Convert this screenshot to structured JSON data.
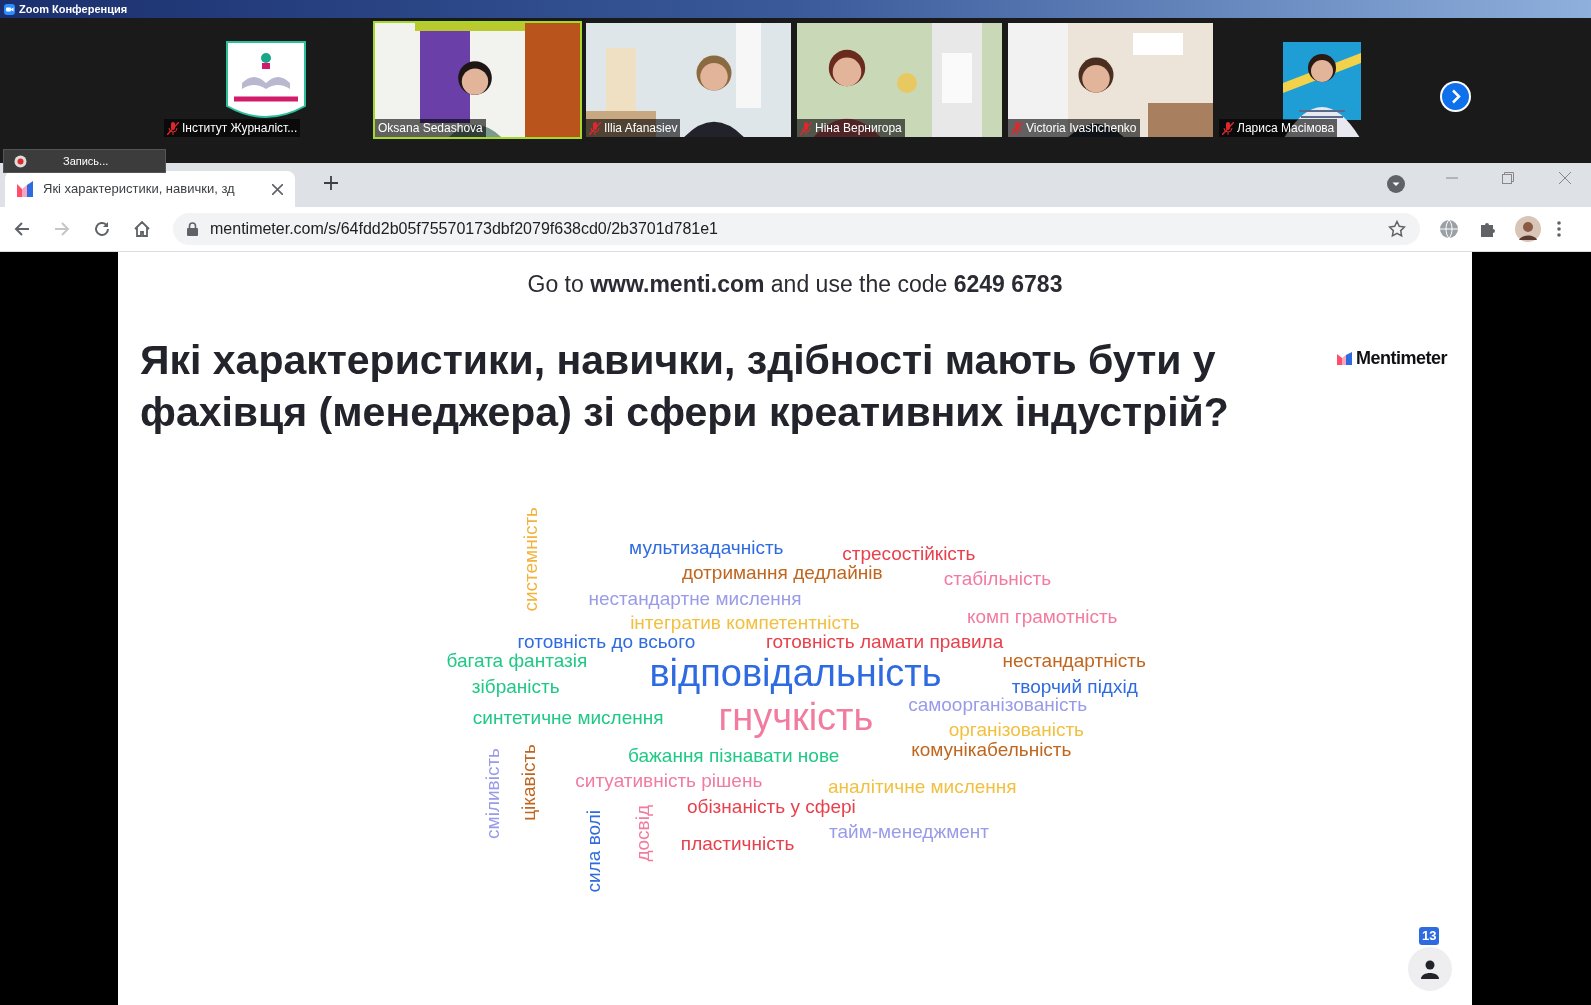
{
  "app": {
    "title": "Zoom Конференция"
  },
  "participants": [
    {
      "name": "Інститут Журналіст...",
      "muted": true,
      "speaking": false,
      "kind": "profile"
    },
    {
      "name": "Oksana Sedashova",
      "muted": false,
      "speaking": true,
      "kind": "video"
    },
    {
      "name": "Illia Afanasiev",
      "muted": true,
      "speaking": false,
      "kind": "video"
    },
    {
      "name": "Ніна Вернигора",
      "muted": true,
      "speaking": false,
      "kind": "video"
    },
    {
      "name": "Victoria Ivashchenko",
      "muted": true,
      "speaking": false,
      "kind": "video"
    },
    {
      "name": "Лариса Масімова",
      "muted": true,
      "speaking": false,
      "kind": "profile"
    }
  ],
  "recording": {
    "label": "Запись..."
  },
  "browser": {
    "tabs": [
      {
        "title": "Які характеристики, навички, зд",
        "selected": true
      }
    ],
    "address": "mentimeter.com/s/64fdd2b05f75570173dbf2079f638cd0/2b3701d781e1",
    "forward_disabled": true
  },
  "slide": {
    "instructions": "Go to **www.menti.com** and use the code **6249 6783**",
    "brand": "Mentimeter",
    "question": "Які характеристики, навички, здібності мають бути у фахівця (менеджера) зі сфери креативних індустрій?",
    "words": [
      {
        "text": "системність",
        "color": "#f2b33d",
        "kind": "vertical"
      },
      {
        "text": "мультизадачність",
        "color": "#2f6be0",
        "kind": "horizontal"
      },
      {
        "text": "стресостійкість",
        "color": "#e8404c",
        "kind": "horizontal"
      },
      {
        "text": "дотримання дедлайнів",
        "color": "#c0661e",
        "kind": "horizontal"
      },
      {
        "text": "стабільність",
        "color": "#f27ba0",
        "kind": "horizontal"
      },
      {
        "text": "нестандартне мислення",
        "color": "#9a9be8",
        "kind": "horizontal"
      },
      {
        "text": "інтегратив компетентність",
        "color": "#f2c040",
        "kind": "horizontal"
      },
      {
        "text": "комп грамотність",
        "color": "#f27ba0",
        "kind": "horizontal"
      },
      {
        "text": "готовність до всього",
        "color": "#2f6be0",
        "kind": "horizontal"
      },
      {
        "text": "готовність ламати правила",
        "color": "#e8404c",
        "kind": "horizontal"
      },
      {
        "text": "багата фантазія",
        "color": "#1fc985",
        "kind": "horizontal"
      },
      {
        "text": "відповідальність",
        "color": "#2f6be0",
        "kind": "headline"
      },
      {
        "text": "нестандартність",
        "color": "#c0661e",
        "kind": "horizontal"
      },
      {
        "text": "зібраність",
        "color": "#1fc985",
        "kind": "horizontal"
      },
      {
        "text": "творчий підхід",
        "color": "#2f6be0",
        "kind": "horizontal"
      },
      {
        "text": "самоорганізованість",
        "color": "#9a9be8",
        "kind": "horizontal"
      },
      {
        "text": "синтетичне мислення",
        "color": "#1fc985",
        "kind": "horizontal"
      },
      {
        "text": "гнучкість",
        "color": "#f27ba0",
        "kind": "headline"
      },
      {
        "text": "організованість",
        "color": "#f2c040",
        "kind": "horizontal"
      },
      {
        "text": "бажання пізнавати нове",
        "color": "#1fc985",
        "kind": "horizontal"
      },
      {
        "text": "комунікабельність",
        "color": "#c0661e",
        "kind": "horizontal"
      },
      {
        "text": "сміливість",
        "color": "#9a9be8",
        "kind": "vertical"
      },
      {
        "text": "цікавість",
        "color": "#c0661e",
        "kind": "vertical"
      },
      {
        "text": "ситуативність рішень",
        "color": "#f27ba0",
        "kind": "horizontal"
      },
      {
        "text": "аналітичне мислення",
        "color": "#f2c040",
        "kind": "horizontal"
      },
      {
        "text": "обізнаність у сфері",
        "color": "#e8404c",
        "kind": "horizontal"
      },
      {
        "text": "тайм-менеджмент",
        "color": "#9a9be8",
        "kind": "horizontal"
      },
      {
        "text": "сила волі",
        "color": "#2f6be0",
        "kind": "vertical"
      },
      {
        "text": "досвід",
        "color": "#f27ba0",
        "kind": "vertical"
      },
      {
        "text": "пластичність",
        "color": "#e8404c",
        "kind": "horizontal"
      }
    ],
    "participant_count": "13"
  }
}
